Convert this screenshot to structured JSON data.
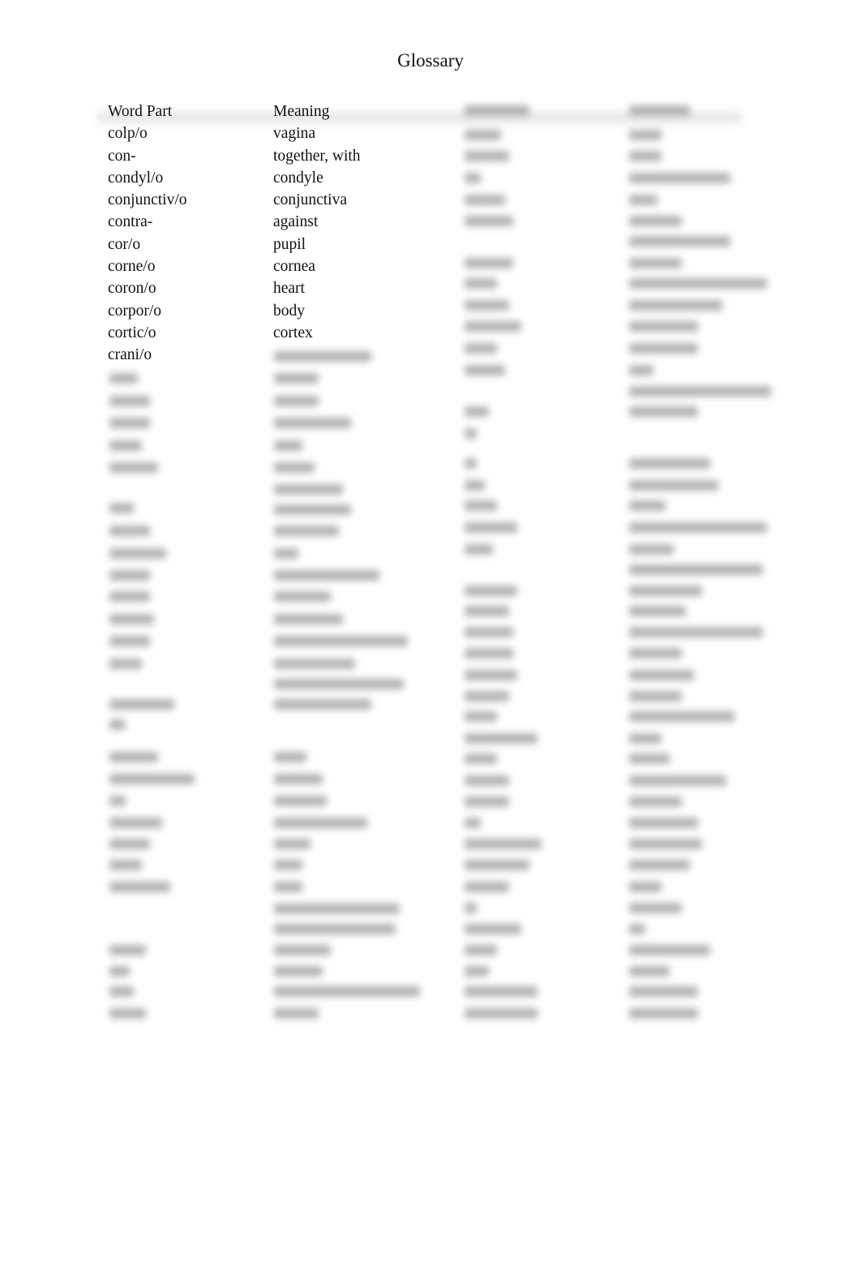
{
  "document": {
    "title": "Glossary"
  },
  "table": {
    "headers": {
      "word_part": "Word Part",
      "meaning": "Meaning"
    },
    "rows": [
      {
        "word_part": "colp/o",
        "meaning": "vagina"
      },
      {
        "word_part": "con-",
        "meaning": "together, with"
      },
      {
        "word_part": "condyl/o",
        "meaning": "condyle"
      },
      {
        "word_part": "conjunctiv/o",
        "meaning": "conjunctiva"
      },
      {
        "word_part": "contra-",
        "meaning": "against"
      },
      {
        "word_part": "cor/o",
        "meaning": "pupil"
      },
      {
        "word_part": "corne/o",
        "meaning": "cornea"
      },
      {
        "word_part": "coron/o",
        "meaning": "heart"
      },
      {
        "word_part": "corpor/o",
        "meaning": "body"
      },
      {
        "word_part": "cortic/o",
        "meaning": "cortex"
      },
      {
        "word_part": "crani/o",
        "meaning": ""
      }
    ]
  },
  "blurred_content": {
    "note_visible": false
  }
}
